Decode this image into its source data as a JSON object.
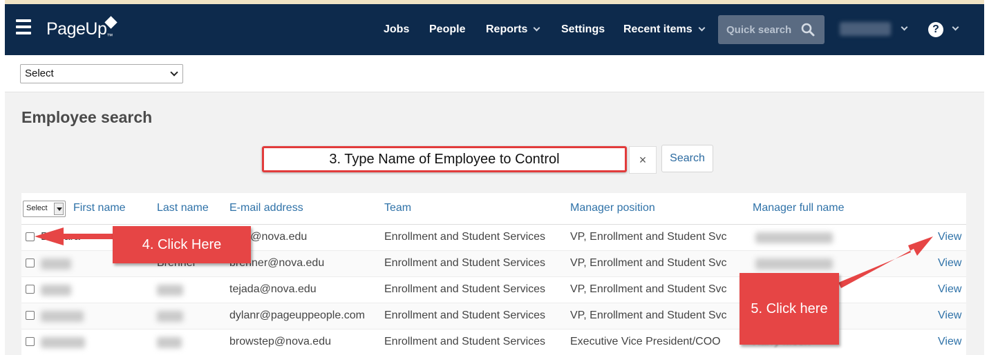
{
  "nav": {
    "logo": "PageUp",
    "logo_tm": "™",
    "items": [
      "Jobs",
      "People",
      "Reports",
      "Settings",
      "Recent items"
    ],
    "quick_search_placeholder": "Quick search",
    "help": "?"
  },
  "filter": {
    "select_value": "Select"
  },
  "page_title": "Employee search",
  "search": {
    "input_value": "3. Type Name of Employee to Control",
    "clear": "×",
    "button": "Search"
  },
  "table": {
    "select_value": "Select",
    "columns": [
      "First name",
      "Last name",
      "E-mail address",
      "Team",
      "Manager position",
      "Manager full name"
    ],
    "rows": [
      {
        "first": "Barbara",
        "last": "",
        "email": "nket@nova.edu",
        "team": "Enrollment and Student Services",
        "position": "VP, Enrollment and Student Svc",
        "manager": "",
        "view": "View"
      },
      {
        "first": "",
        "last": "Brenner",
        "email": "brenner@nova.edu",
        "team": "Enrollment and Student Services",
        "position": "VP, Enrollment and Student Svc",
        "manager": "",
        "view": "View"
      },
      {
        "first": "",
        "last": "",
        "email": "tejada@nova.edu",
        "team": "Enrollment and Student Services",
        "position": "VP, Enrollment and Student Svc",
        "manager": "",
        "view": "View"
      },
      {
        "first": "",
        "last": "",
        "email": "dylanr@pageuppeople.com",
        "team": "Enrollment and Student Services",
        "position": "VP, Enrollment and Student Svc",
        "manager": "",
        "view": "View"
      },
      {
        "first": "",
        "last": "",
        "email": "browstep@nova.edu",
        "team": "Enrollment and Student Services",
        "position": "Executive Vice President/COO",
        "manager": "Harry Moon",
        "view": "View"
      }
    ]
  },
  "callouts": {
    "click_here_4": "4. Click Here",
    "click_here_5": "5. Click here"
  },
  "colors": {
    "nav_bg": "#0d2a4c",
    "link": "#2f72a8",
    "callout": "#e64545"
  }
}
